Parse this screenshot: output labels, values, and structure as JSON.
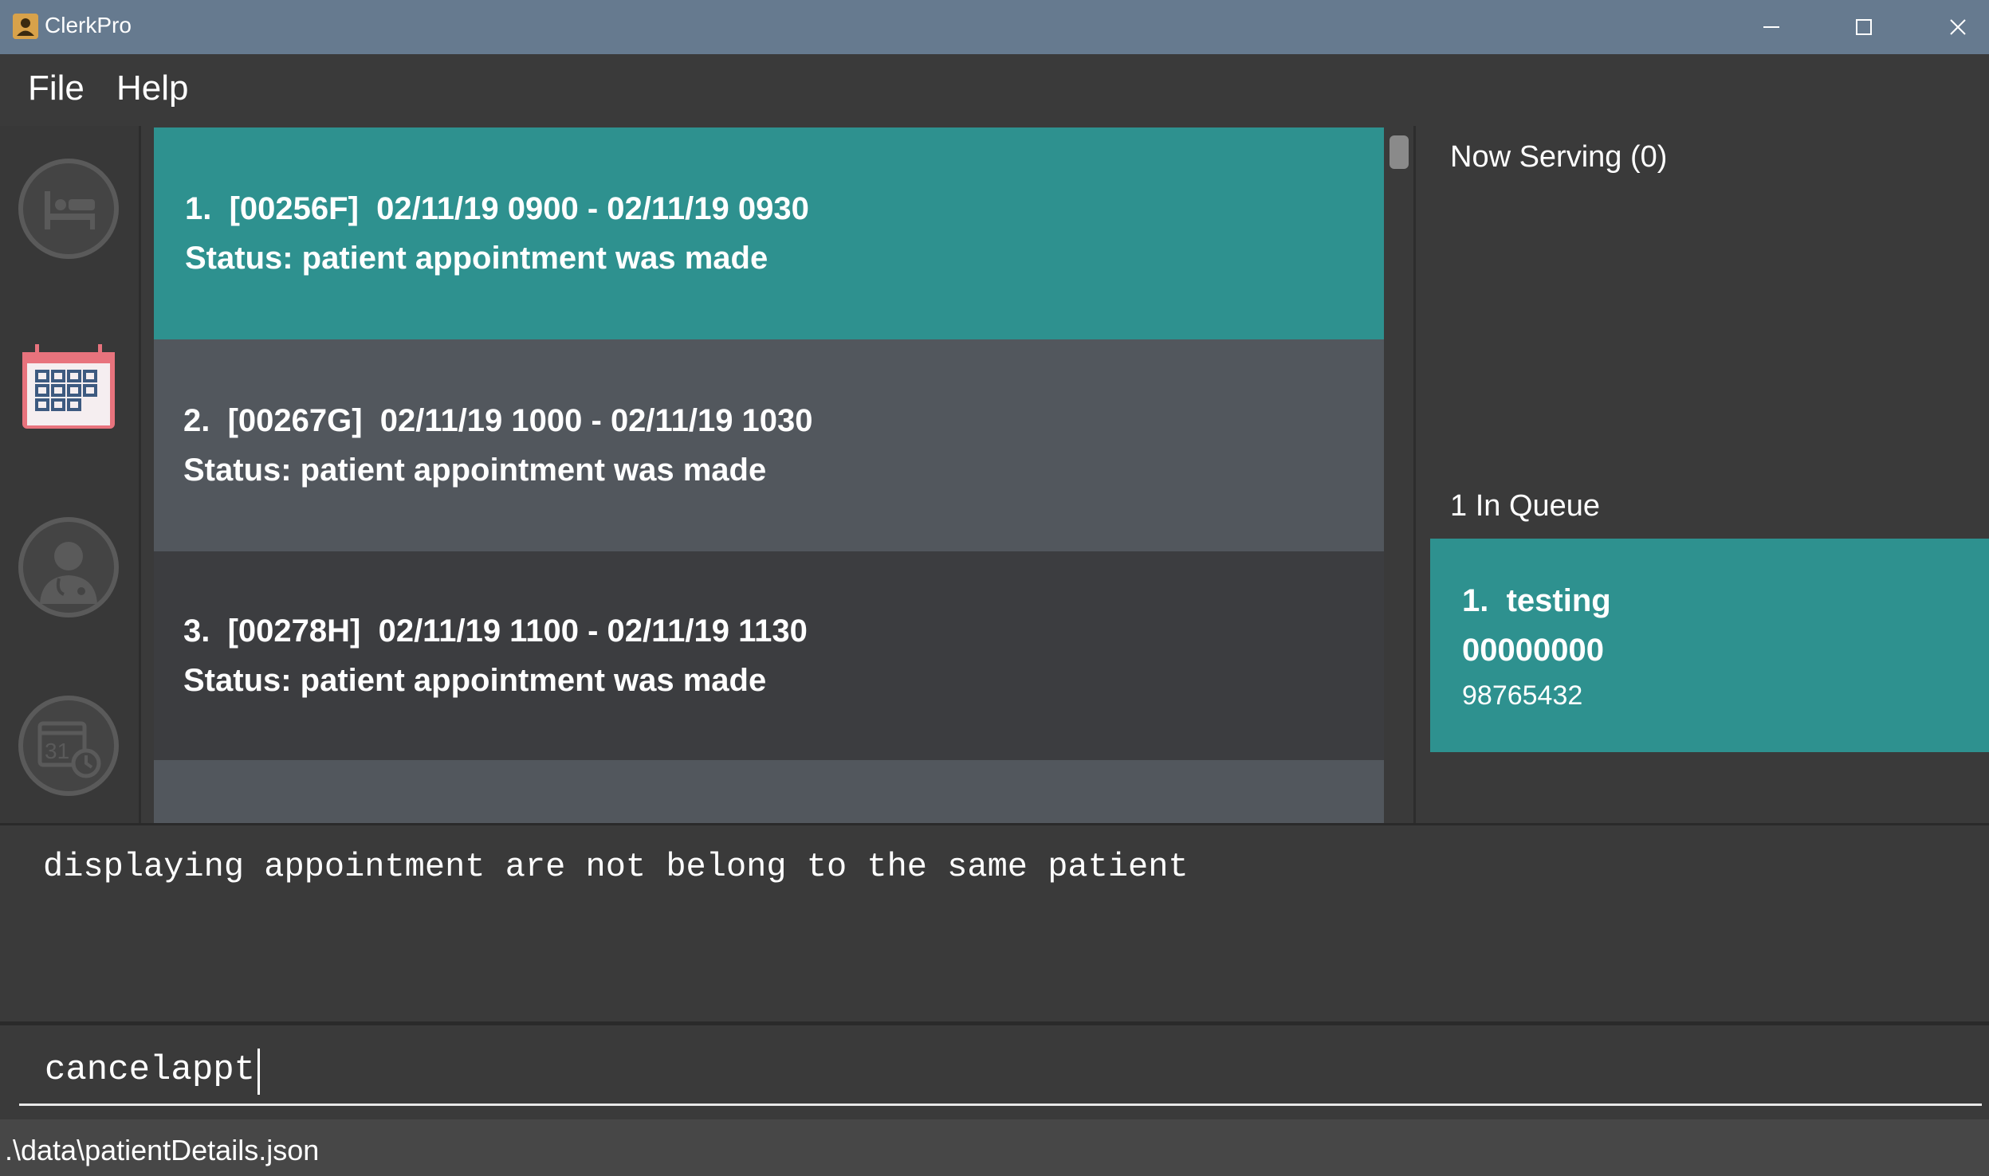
{
  "window": {
    "title": "ClerkPro",
    "controls": [
      "minimize",
      "maximize",
      "close"
    ]
  },
  "menu": {
    "items": [
      "File",
      "Help"
    ]
  },
  "sidebar": {
    "items": [
      {
        "icon": "bed-icon",
        "active": false
      },
      {
        "icon": "calendar-icon",
        "active": true
      },
      {
        "icon": "doctor-icon",
        "active": false
      },
      {
        "icon": "calendar-clock-icon",
        "active": false
      }
    ]
  },
  "appointments": {
    "items": [
      {
        "line1": "1.  [00256F]  02/11/19 0900 - 02/11/19 0930",
        "line2": "Status: patient appointment was made",
        "selected": true
      },
      {
        "line1": "2.  [00267G]  02/11/19 1000 - 02/11/19 1030",
        "line2": "Status: patient appointment was made",
        "selected": false
      },
      {
        "line1": "3.  [00278H]  02/11/19 1100 - 02/11/19 1130",
        "line2": "Status: patient appointment was made",
        "selected": false
      }
    ]
  },
  "queue": {
    "now_serving_label": "Now Serving (0)",
    "in_queue_label": "1 In Queue",
    "entries": [
      {
        "name": "1.  testing",
        "id": "00000000",
        "phone": "98765432"
      }
    ]
  },
  "result": {
    "text": "displaying appointment are not belong to the same patient"
  },
  "command": {
    "value": "cancelappt"
  },
  "status": {
    "path": ".\\data\\patientDetails.json"
  },
  "colors": {
    "selected": "#2e918f",
    "card_light": "#52575d",
    "card_dark": "#3c3d40",
    "background": "#3a3a3a",
    "titlebar": "#667a8f"
  }
}
